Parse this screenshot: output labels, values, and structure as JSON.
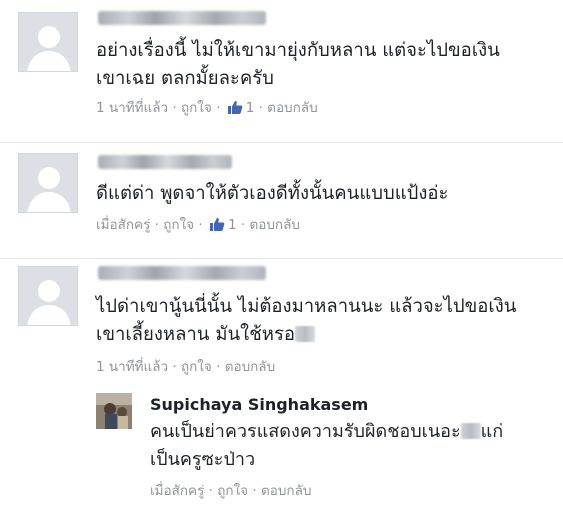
{
  "comments": [
    {
      "text_line1": "อย่างเรื่องนี้ ไม่ให้เขามายุ่งกับหลาน แต่จะไปขอเงิน",
      "text_line2": "เขาเฉย ตลกมั้ยละครับ",
      "time": "1 นาทีที่แล้ว",
      "like": "ถูกใจ",
      "like_count": "1",
      "reply": "ตอบกลับ"
    },
    {
      "text_line1": "ดีแต่ด่า พูดจาให้ตัวเองดีทั้งนั้นคนแบบแป้งอ่ะ",
      "time": "เมื่อสักครู่",
      "like": "ถูกใจ",
      "like_count": "1",
      "reply": "ตอบกลับ"
    },
    {
      "text_line1": "ไปด่าเขานู้นนี่นั้น ไม่ต้องมาหลานนะ แล้วจะไปขอเงิน",
      "text_line2": "เขาเลี้ยงหลาน มันใช้หรอ",
      "time": "1 นาทีที่แล้ว",
      "like": "ถูกใจ",
      "reply": "ตอบกลับ",
      "reply_comment": {
        "name": "Supichaya Singhakasem",
        "text_line1a": "คนเป็นย่าควรแสดงความรับผิดชอบเนอะ",
        "text_line1b": "แก่",
        "text_line2": "เป็นครูซะป่าว",
        "time": "เมื่อสักครู่",
        "like": "ถูกใจ",
        "reply": "ตอบกลับ"
      }
    }
  ],
  "colors": {
    "meta": "#90949c",
    "text": "#1d2129",
    "like_blue": "#4267b2"
  },
  "icons": {
    "like": "thumbs-up-icon",
    "avatar": "default-avatar-icon"
  }
}
